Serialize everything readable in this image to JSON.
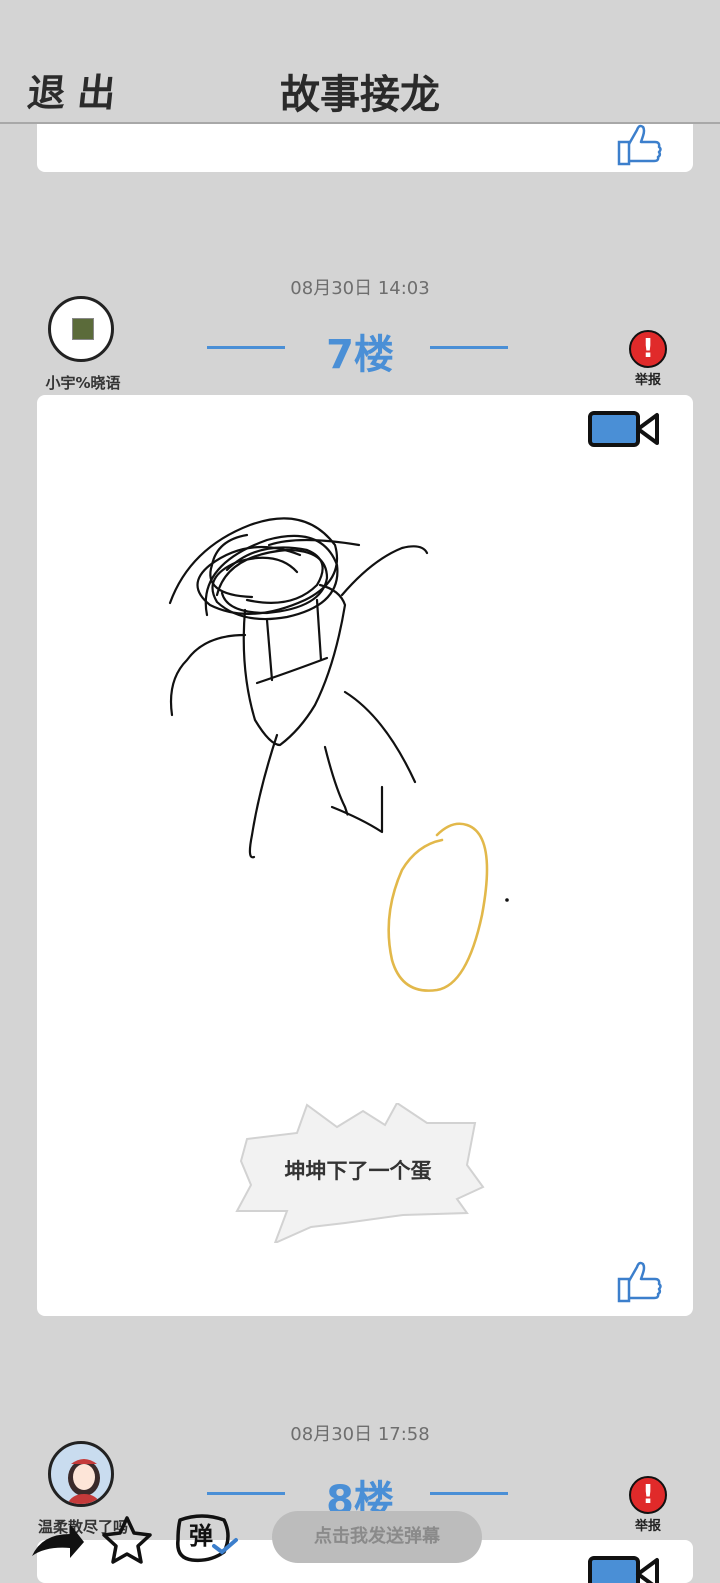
{
  "header": {
    "exit_label": "退出",
    "title": "故事接龙"
  },
  "posts": [
    {
      "timestamp": "08月30日 14:03",
      "floor": "7楼",
      "username": "小宇%晓语",
      "report_label": "举报",
      "caption": "坤坤下了一个蛋"
    },
    {
      "timestamp": "08月30日 17:58",
      "floor": "8楼",
      "username": "温柔散尽了吗",
      "report_label": "举报"
    }
  ],
  "bottom": {
    "danmaku_placeholder": "点击我发送弹幕",
    "danmaku_icon_label": "弹"
  },
  "colors": {
    "accent": "#4a8fd6",
    "report": "#e02a2a",
    "background": "#d4d4d4",
    "egg": "#e2b84a"
  }
}
